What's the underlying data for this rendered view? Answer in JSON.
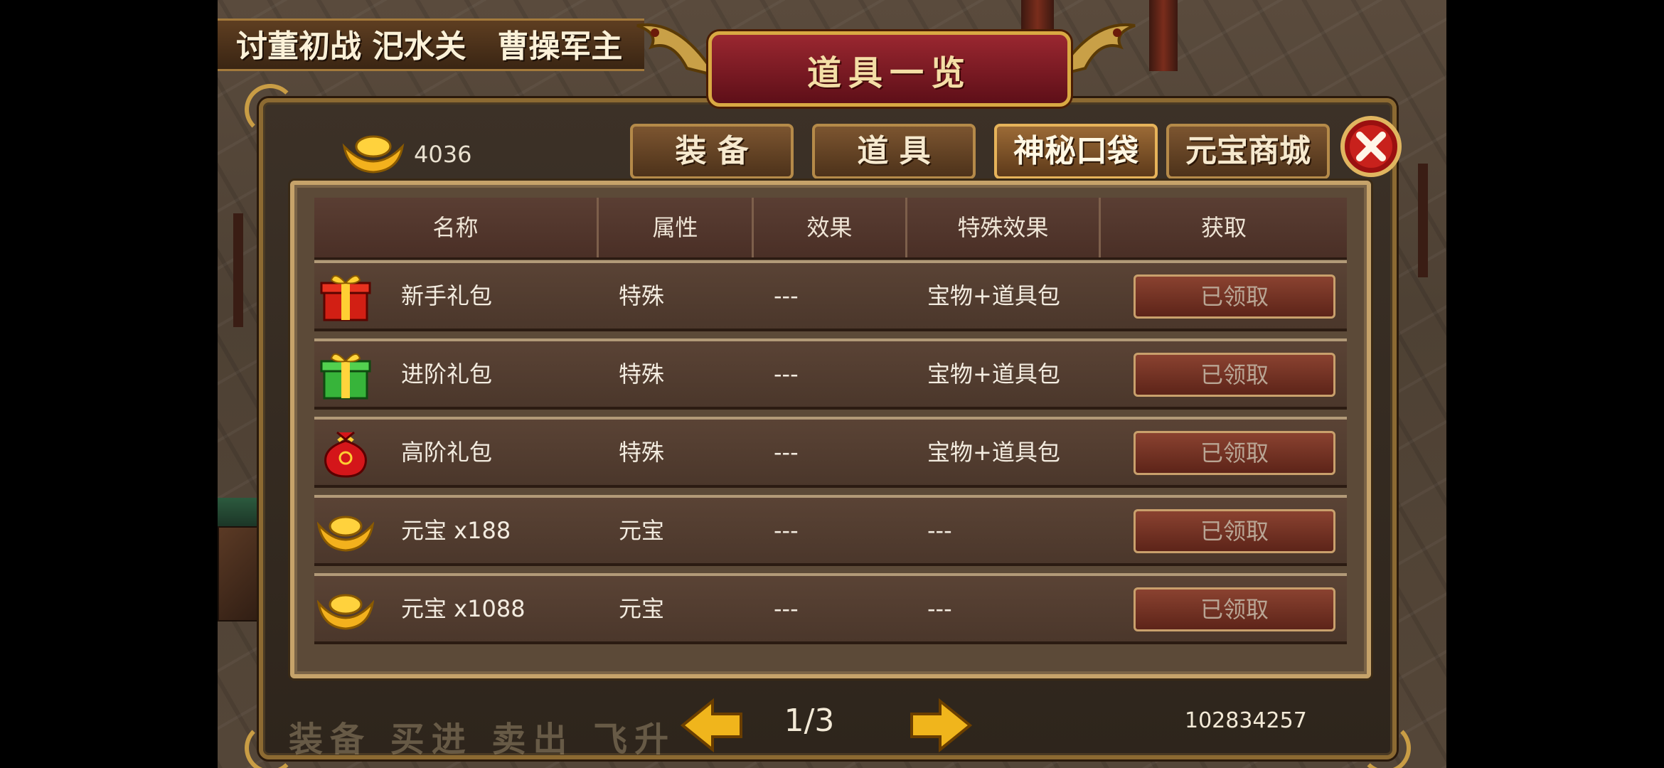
{
  "location_banner": "讨董初战 汜水关　曹操军主",
  "dialog": {
    "title": "道具一览",
    "currency": {
      "icon": "gold-ingot-icon",
      "value": "4036"
    },
    "tabs": [
      {
        "label": "装 备",
        "active": false
      },
      {
        "label": "道 具",
        "active": false
      },
      {
        "label": "神秘口袋",
        "active": true
      },
      {
        "label": "元宝商城",
        "active": false
      }
    ],
    "columns": [
      "名称",
      "属性",
      "效果",
      "特殊效果",
      "获取"
    ],
    "rows": [
      {
        "icon": "red-gift-box-icon",
        "name": "新手礼包",
        "attr": "特殊",
        "effect": "---",
        "special": "宝物+道具包",
        "button": "已领取"
      },
      {
        "icon": "green-gift-box-icon",
        "name": "进阶礼包",
        "attr": "特殊",
        "effect": "---",
        "special": "宝物+道具包",
        "button": "已领取"
      },
      {
        "icon": "red-pouch-icon",
        "name": "高阶礼包",
        "attr": "特殊",
        "effect": "---",
        "special": "宝物+道具包",
        "button": "已领取"
      },
      {
        "icon": "gold-ingot-icon",
        "name": "元宝 x188",
        "attr": "元宝",
        "effect": "---",
        "special": "---",
        "button": "已领取"
      },
      {
        "icon": "gold-ingot-icon",
        "name": "元宝 x1088",
        "attr": "元宝",
        "effect": "---",
        "special": "---",
        "button": "已领取"
      }
    ],
    "pagination": {
      "page": "1/3"
    },
    "user_id": "102834257"
  },
  "bottom_menu": "装备 买进 卖出 飞升",
  "colors": {
    "accent_gold": "#d9a943",
    "plaque_red": "#8a1d26",
    "button_red": "#6e2d20"
  }
}
